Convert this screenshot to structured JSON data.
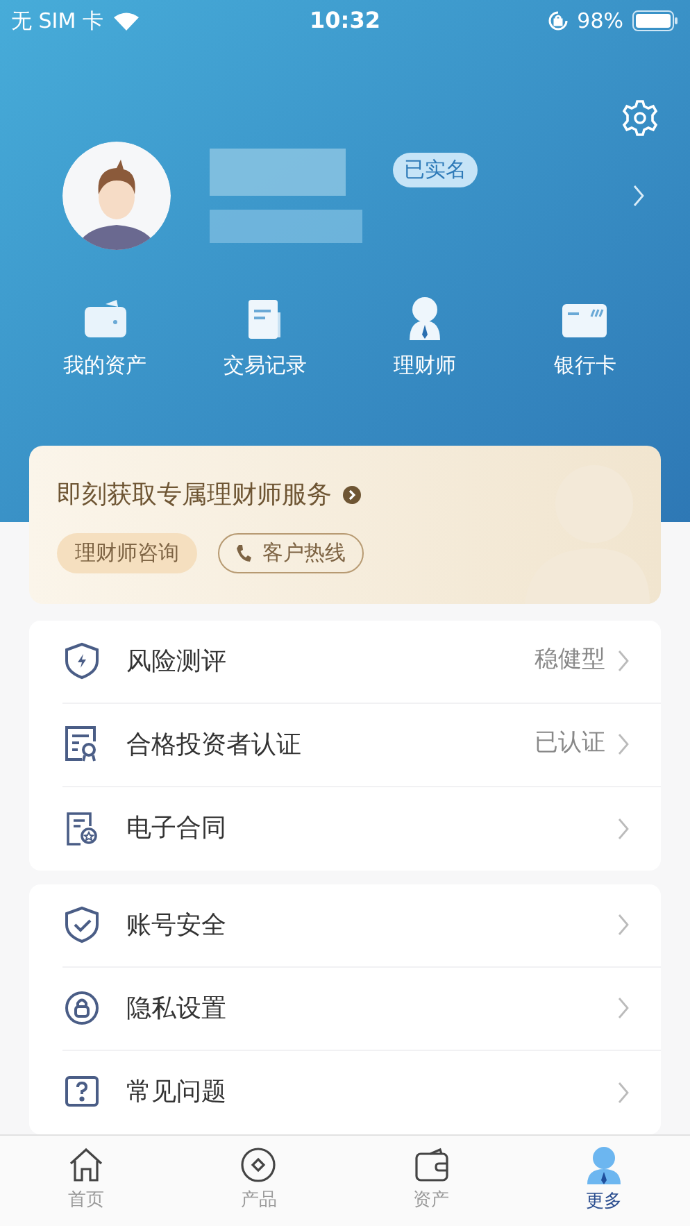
{
  "status_bar": {
    "carrier": "无 SIM 卡",
    "time": "10:32",
    "battery": "98%"
  },
  "profile": {
    "badge": "已实名"
  },
  "shortcuts": [
    {
      "label": "我的资产",
      "kind": "wallet"
    },
    {
      "label": "交易记录",
      "kind": "record"
    },
    {
      "label": "理财师",
      "kind": "advisor"
    },
    {
      "label": "银行卡",
      "kind": "card"
    }
  ],
  "advisor_card": {
    "title": "即刻获取专属理财师服务",
    "buttons": [
      {
        "label": "理财师咨询",
        "kind": "filled"
      },
      {
        "label": "客户热线",
        "kind": "outline"
      }
    ]
  },
  "menu_groups": [
    [
      {
        "label": "风险测评",
        "value": "稳健型",
        "kind": "risk"
      },
      {
        "label": "合格投资者认证",
        "value": "已认证",
        "kind": "cert"
      },
      {
        "label": "电子合同",
        "kind": "contract"
      }
    ],
    [
      {
        "label": "账号安全",
        "kind": "security"
      },
      {
        "label": "隐私设置",
        "kind": "privacy"
      },
      {
        "label": "常见问题",
        "kind": "faq"
      }
    ]
  ],
  "tab_bar": [
    {
      "label": "首页",
      "kind": "home",
      "selected": false
    },
    {
      "label": "产品",
      "kind": "product",
      "selected": false
    },
    {
      "label": "资产",
      "kind": "assets",
      "selected": false
    },
    {
      "label": "更多",
      "kind": "more",
      "selected": true
    }
  ]
}
